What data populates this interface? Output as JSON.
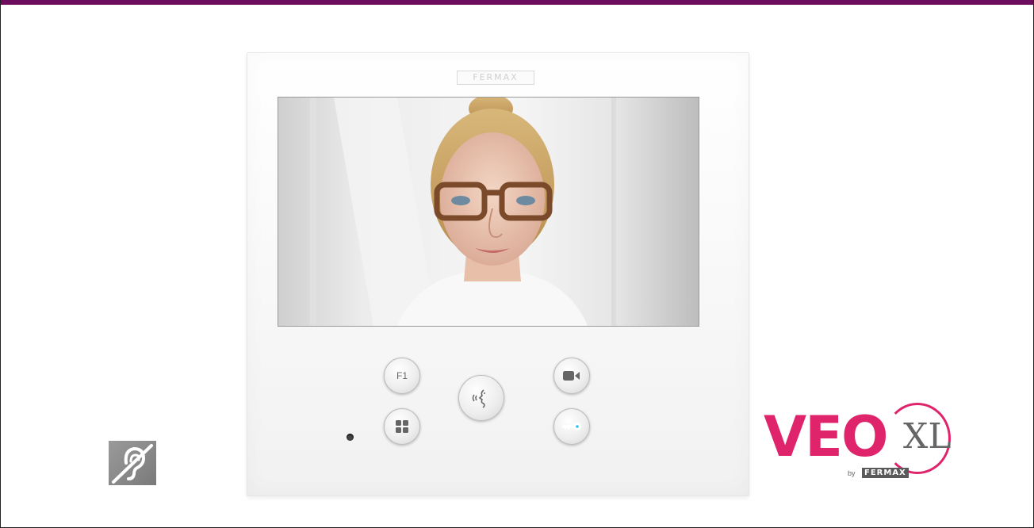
{
  "monitor": {
    "brand_plate": "FERMAX",
    "buttons": {
      "f1_label": "F1"
    }
  },
  "logo": {
    "veo": "VEO",
    "xl": "XL",
    "by": "by",
    "brand": "FERMAX"
  },
  "colors": {
    "top_bar": "#6d0d5e",
    "logo_pink": "#e0246b",
    "key_button": "#2cc1ee"
  },
  "icons": {
    "hearing": "hearing-loop-icon",
    "menu": "grid-menu-icon",
    "talk": "talk-voice-icon",
    "camera": "video-camera-icon",
    "key": "door-key-icon"
  }
}
